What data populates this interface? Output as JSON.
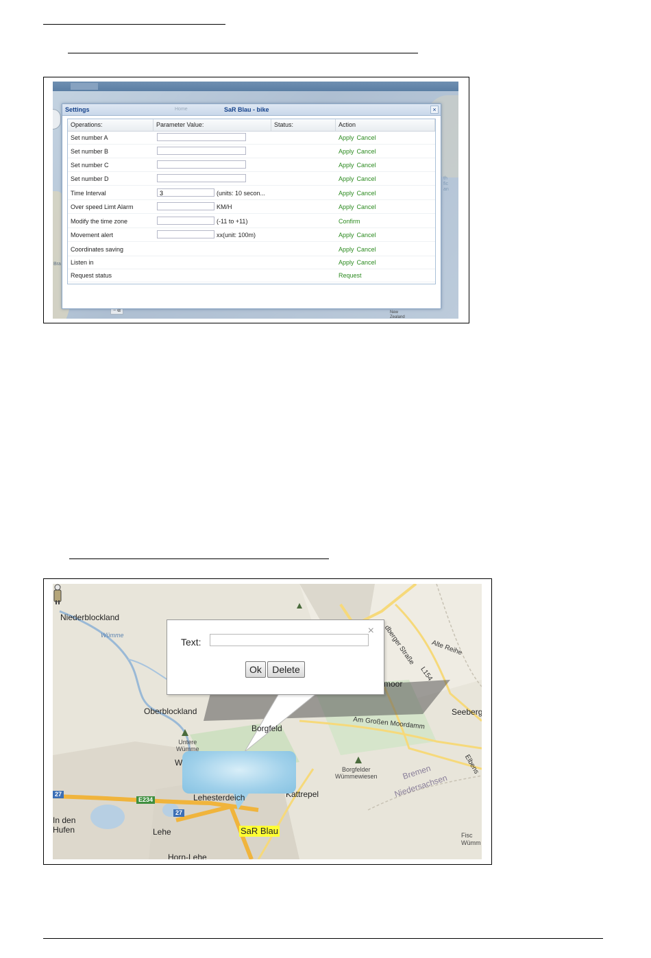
{
  "settings": {
    "title": "Settings",
    "subtitle": "SaR Blau - bike",
    "ghost_text": "Home",
    "columns": [
      "Operations:",
      "Parameter Value:",
      "Status:",
      "Action"
    ],
    "rows": [
      {
        "op": "Set number A",
        "value": "",
        "note": "",
        "actions": [
          "Apply",
          "Cancel"
        ],
        "input": "wide"
      },
      {
        "op": "Set number B",
        "value": "",
        "note": "",
        "actions": [
          "Apply",
          "Cancel"
        ],
        "input": "wide"
      },
      {
        "op": "Set number C",
        "value": "",
        "note": "",
        "actions": [
          "Apply",
          "Cancel"
        ],
        "input": "wide"
      },
      {
        "op": "Set number D",
        "value": "",
        "note": "",
        "actions": [
          "Apply",
          "Cancel"
        ],
        "input": "wide"
      },
      {
        "op": "Time Interval",
        "value": "3",
        "note": "(units: 10 secon...",
        "actions": [
          "Apply",
          "Cancel"
        ],
        "input": "short"
      },
      {
        "op": "Over speed Limt Alarm",
        "value": "",
        "note": "KM/H",
        "actions": [
          "Apply",
          "Cancel"
        ],
        "input": "short"
      },
      {
        "op": "Modify the time zone",
        "value": "",
        "note": "(-11 to +11)",
        "actions": [
          "Confirm"
        ],
        "input": "short"
      },
      {
        "op": "Movement alert",
        "value": "",
        "note": "xx(unit: 100m)",
        "actions": [
          "Apply",
          "Cancel"
        ],
        "input": "short"
      },
      {
        "op": "Coordinates saving",
        "value": "",
        "note": "",
        "actions": [
          "Apply",
          "Cancel"
        ],
        "input": "none"
      },
      {
        "op": "Listen in",
        "value": "",
        "note": "",
        "actions": [
          "Apply",
          "Cancel"
        ],
        "input": "none"
      },
      {
        "op": "Request status",
        "value": "",
        "note": "",
        "actions": [
          "Request"
        ],
        "input": "none"
      }
    ],
    "map_labels": {
      "left": "Bra",
      "right_top": "th\nfic\nan",
      "bottom_right": "New\nZealand"
    }
  },
  "popup": {
    "text_label": "Text:",
    "text_value": "",
    "ok_label": "Ok",
    "delete_label": "Delete",
    "close_glyph": "×"
  },
  "map": {
    "marker_label": "SaR Blau",
    "labels": {
      "niederblockland": "Niederblockland",
      "wumme": "Wümme",
      "oberblockland": "Oberblockland",
      "untere_wumme": "Untere\nWümme",
      "borgfeld": "Borgfeld",
      "borgfelder": "Borgfelder\nWümmewiesen",
      "lehesterdeich": "Lehesterdeich",
      "kattrepel": "Kattrepel",
      "in_den_hufen": "In den\nHufen",
      "lehe": "Lehe",
      "horn_lehe": "Horn-Lehe",
      "moor": "moor",
      "seebergen": "Seeberg",
      "am_grossen_moordamm": "Am Großen Moordamm",
      "bremen": "Bremen",
      "niedersachsen": "Niedersachsen",
      "alte_reihe": "Alte Reihe",
      "strasse": "dberger Straße",
      "l154": "L154",
      "elbens": "Elbens",
      "fisch": "Fisc\nWümm",
      "w": "W"
    },
    "shields": {
      "a27_left": "27",
      "e234": "E234",
      "a27_mid": "27"
    }
  }
}
